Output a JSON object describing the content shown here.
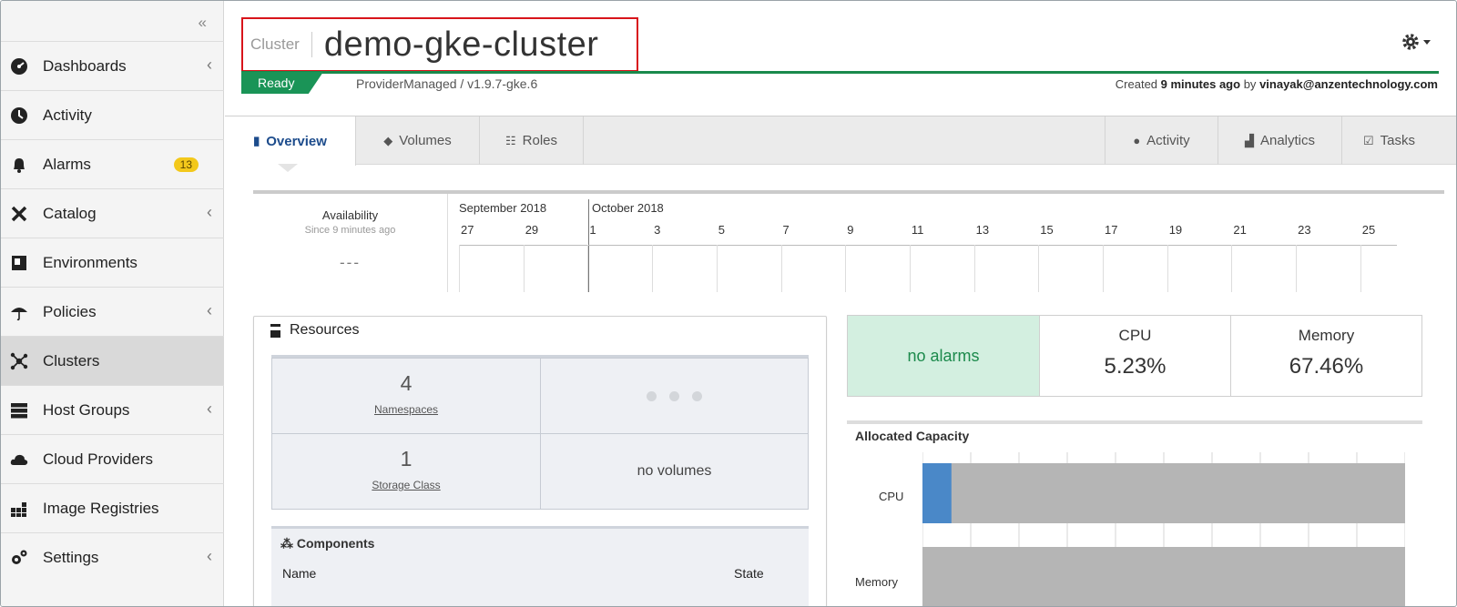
{
  "sidebar": {
    "collapse_label": "«",
    "items": [
      {
        "label": "Dashboards",
        "icon": "dashboard-icon",
        "chevron": "‹"
      },
      {
        "label": "Activity",
        "icon": "activity-icon"
      },
      {
        "label": "Alarms",
        "icon": "bell-icon",
        "badge": "13"
      },
      {
        "label": "Catalog",
        "icon": "tools-icon",
        "chevron": "‹"
      },
      {
        "label": "Environments",
        "icon": "environments-icon"
      },
      {
        "label": "Policies",
        "icon": "umbrella-icon",
        "chevron": "‹"
      },
      {
        "label": "Clusters",
        "icon": "clusters-icon",
        "active": true
      },
      {
        "label": "Host Groups",
        "icon": "server-icon",
        "chevron": "‹"
      },
      {
        "label": "Cloud Providers",
        "icon": "cloud-icon"
      },
      {
        "label": "Image Registries",
        "icon": "registry-icon"
      },
      {
        "label": "Settings",
        "icon": "gears-icon",
        "chevron": "‹"
      }
    ]
  },
  "header": {
    "title_prefix": "Cluster",
    "title": "demo-gke-cluster",
    "status": "Ready",
    "provider": "ProviderManaged / v1.9.7-gke.6",
    "created_prefix": "Created",
    "created_ago": "9 minutes ago",
    "created_by_prefix": "by",
    "created_by": "vinayak@anzentechnology.com"
  },
  "tabs": {
    "left": [
      {
        "label": "Overview",
        "icon": "overview-icon",
        "active": true
      },
      {
        "label": "Volumes",
        "icon": "tag-icon"
      },
      {
        "label": "Roles",
        "icon": "roles-icon"
      }
    ],
    "right": [
      {
        "label": "Activity",
        "icon": "activity-icon"
      },
      {
        "label": "Analytics",
        "icon": "chart-icon"
      },
      {
        "label": "Tasks",
        "icon": "tasks-icon"
      }
    ]
  },
  "availability": {
    "title": "Availability",
    "subtitle": "Since 9 minutes ago",
    "value": "---",
    "months": [
      "September 2018",
      "October 2018"
    ],
    "ticks": [
      "27",
      "29",
      "1",
      "3",
      "5",
      "7",
      "9",
      "11",
      "13",
      "15",
      "17",
      "19",
      "21",
      "23",
      "25"
    ]
  },
  "resources": {
    "title": "Resources",
    "namespaces_count": "4",
    "namespaces_label": "Namespaces",
    "storage_count": "1",
    "storage_label": "Storage Class",
    "volumes_text": "no volumes",
    "components_title": "Components",
    "col_name": "Name",
    "col_state": "State"
  },
  "stats": {
    "alarms_text": "no alarms",
    "cpu_label": "CPU",
    "cpu_value": "5.23%",
    "memory_label": "Memory",
    "memory_value": "67.46%"
  },
  "capacity": {
    "title": "Allocated Capacity",
    "rows": [
      {
        "label": "CPU",
        "fraction": 0.06
      },
      {
        "label": "Memory",
        "fraction": 0.0
      }
    ]
  },
  "colors": {
    "accent_blue": "#1d4c8c",
    "ready_green": "#1a9457",
    "alarm_bg": "#d3efe0",
    "badge_yellow": "#f3c81b",
    "bar_blue": "#4a88c8",
    "bar_gray": "#b5b5b5"
  }
}
